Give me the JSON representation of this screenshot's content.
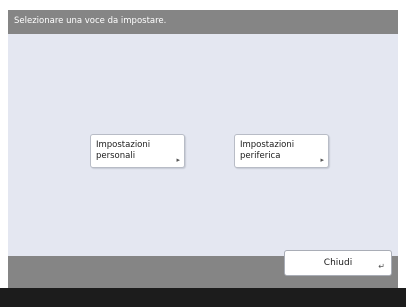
{
  "header": {
    "instruction": "Selezionare una voce da impostare."
  },
  "options": [
    {
      "line1": "Impostazioni",
      "line2": "personali"
    },
    {
      "line1": "Impostazioni",
      "line2": "periferica"
    }
  ],
  "footer": {
    "close_label": "Chiudi"
  }
}
